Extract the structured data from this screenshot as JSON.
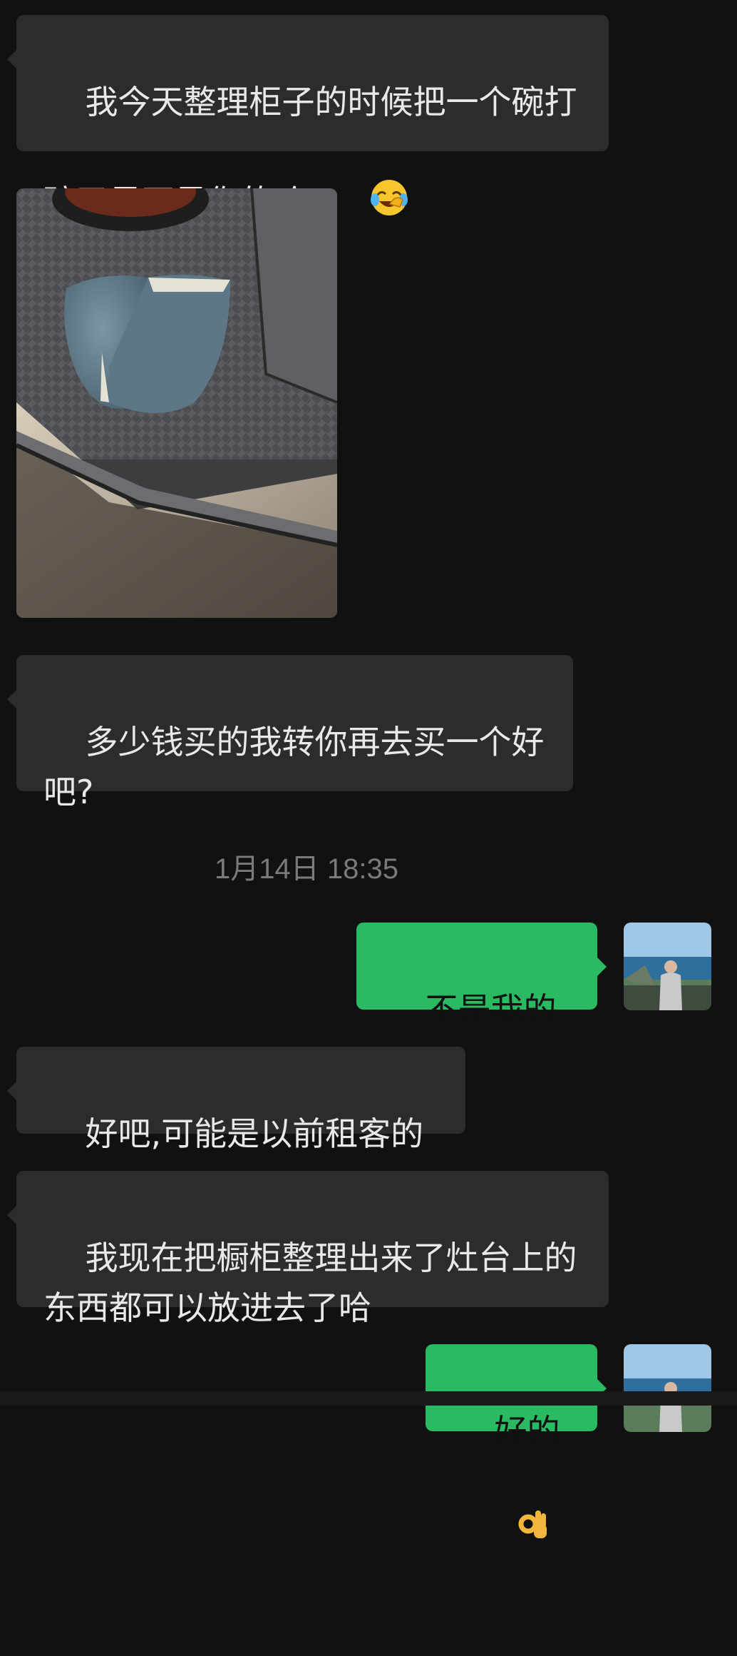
{
  "messages": [
    {
      "side": "in",
      "text": "我今天整理柜子的时候把一个碗打碎了是不是你的哈",
      "emoji": "face-with-tears-of-joy"
    },
    {
      "side": "in",
      "type": "image",
      "image": "broken blue-gray bowl on stove"
    },
    {
      "side": "in",
      "text": "多少钱买的我转你再去买一个好吧?"
    },
    {
      "side": "out",
      "text": "不是我的哈"
    },
    {
      "side": "in",
      "text": "好吧,可能是以前租客的"
    },
    {
      "side": "in",
      "text": "我现在把橱柜整理出来了灶台上的东西都可以放进去了哈"
    },
    {
      "side": "out",
      "text": "好的",
      "emoji": "ok-hand"
    }
  ],
  "timestamp": "1月14日 18:35",
  "colors": {
    "background": "#111111",
    "incoming_bubble": "#2c2c2c",
    "outgoing_bubble": "#2aba62",
    "timestamp": "#7a7a7a"
  }
}
